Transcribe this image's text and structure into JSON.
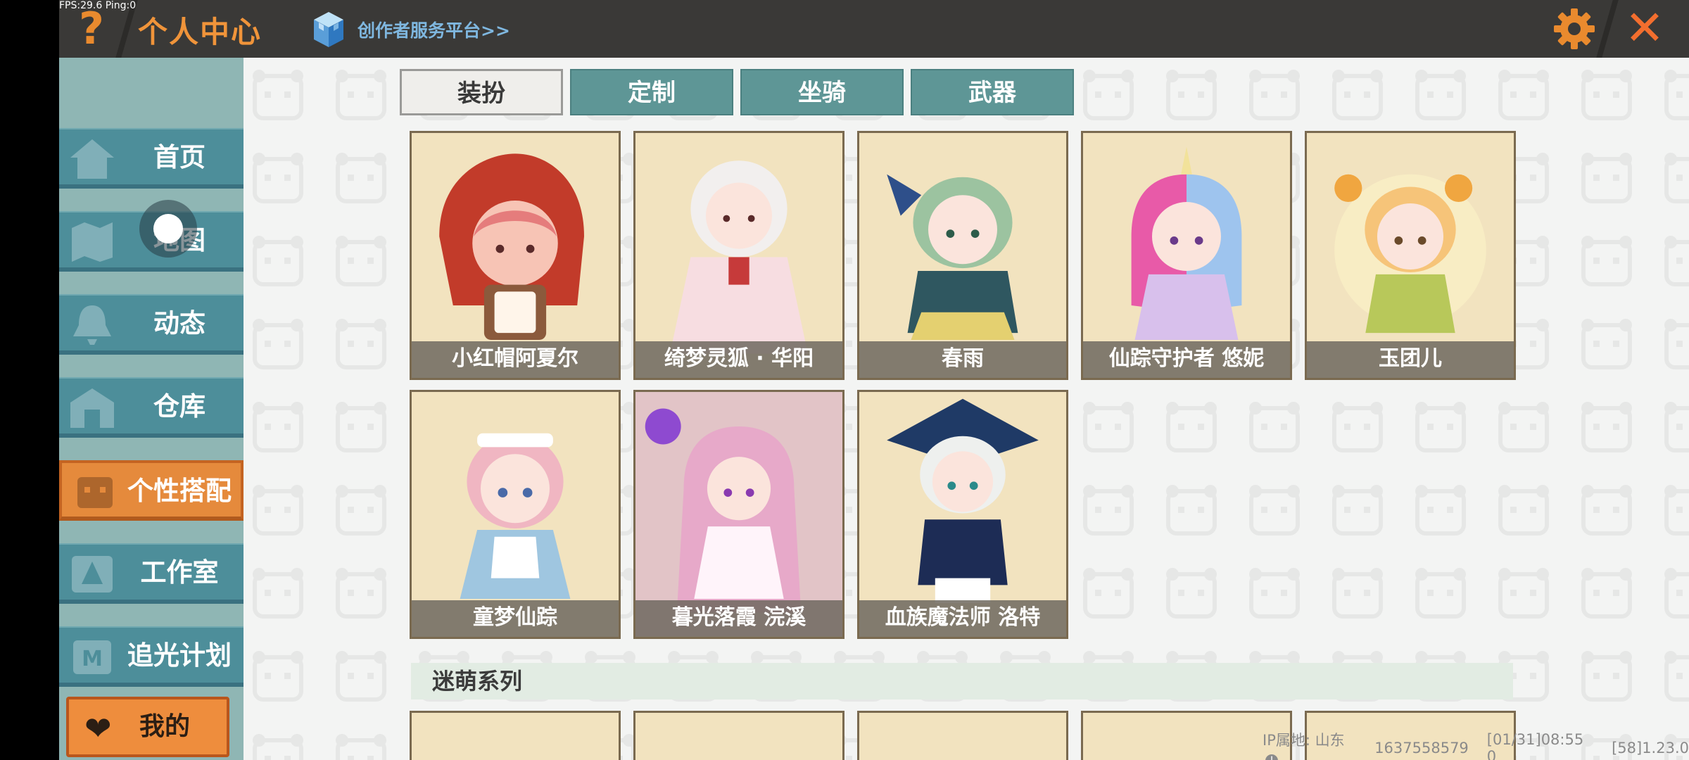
{
  "overlay": {
    "fps_text": "FPS:29.6  Ping:0"
  },
  "header": {
    "help_icon": "question-mark-icon",
    "title": "个人中心",
    "creator_link": "创作者服务平台>>",
    "settings_icon": "gear-icon",
    "close_icon": "close-icon"
  },
  "sidebar": {
    "items": [
      {
        "label": "首页",
        "icon": "home-icon"
      },
      {
        "label": "地图",
        "icon": "map-icon"
      },
      {
        "label": "动态",
        "icon": "bell-icon"
      },
      {
        "label": "仓库",
        "icon": "warehouse-icon"
      },
      {
        "label": "个性搭配",
        "icon": "character-icon",
        "active": true
      },
      {
        "label": "工作室",
        "icon": "studio-icon"
      },
      {
        "label": "追光计划",
        "icon": "plan-icon"
      }
    ],
    "my_button": "我的"
  },
  "tabs": [
    {
      "label": "装扮",
      "active": true
    },
    {
      "label": "定制"
    },
    {
      "label": "坐骑"
    },
    {
      "label": "武器"
    }
  ],
  "skins": [
    {
      "name": "小红帽阿夏尔"
    },
    {
      "name": "绮梦灵狐 · 华阳"
    },
    {
      "name": "春雨"
    },
    {
      "name": "仙踪守护者 悠妮"
    },
    {
      "name": "玉团儿"
    },
    {
      "name": "童梦仙踪"
    },
    {
      "name": "暮光落霞 浣溪"
    },
    {
      "name": "血族魔法师 洛特"
    }
  ],
  "section": {
    "title": "迷萌系列"
  },
  "status": {
    "ip_location": "IP属地: 山东",
    "uid": "1637558579",
    "timestamp": "[01/31]08:55 0",
    "version": "[58]1.23.0"
  },
  "colors": {
    "accent_orange": "#f0943a",
    "tab_teal": "#5e9696",
    "nav_teal": "#4d8e9a",
    "link_blue": "#7fb7df"
  }
}
